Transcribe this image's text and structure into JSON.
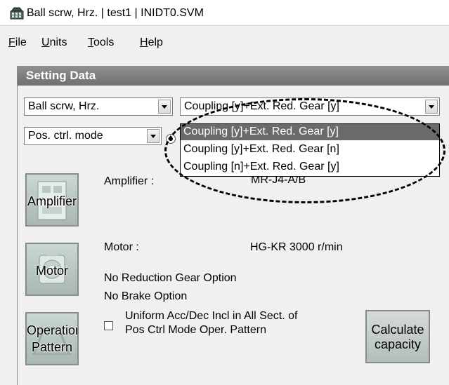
{
  "window": {
    "title": "Ball scrw, Hrz.  | test1 | INIDT0.SVM",
    "icon": "app-grid-icon"
  },
  "menu": {
    "items": [
      {
        "label": "File",
        "accel": "F",
        "rest": "ile"
      },
      {
        "label": "Units",
        "accel": "U",
        "rest": "nits"
      },
      {
        "label": "Tools",
        "accel": "T",
        "rest": "ools"
      },
      {
        "label": "Help",
        "accel": "H",
        "rest": "elp"
      }
    ]
  },
  "panel": {
    "title": "Setting Data",
    "mechanism_select": "Ball scrw, Hrz.",
    "gear_select": "Coupling [y]+Ext. Red. Gear [y]",
    "mode_select": "Pos. ctrl. mode",
    "gear_options": [
      "Coupling [y]+Ext. Red. Gear [y]",
      "Coupling [y]+Ext. Red. Gear [n]",
      "Coupling [n]+Ext. Red. Gear [y]"
    ],
    "gear_selected_index": 0,
    "amplifier": {
      "button_label": "Amplifier",
      "label": "Amplifier :",
      "value": "MR-J4-A/B"
    },
    "motor": {
      "button_label": "Motor",
      "label": "Motor :",
      "value": "HG-KR  3000 r/min",
      "reduction_gear": "No Reduction Gear Option",
      "brake": "No Brake Option"
    },
    "operation": {
      "button_label_1": "Operation",
      "button_label_2": "Pattern",
      "checkbox_line_1": "Uniform Acc/Dec Incl in All Sect. of",
      "checkbox_line_2": "Pos Ctrl Mode Oper. Pattern",
      "checked": false
    },
    "calculate": {
      "label_1": "Calculate",
      "label_2": "capacity"
    }
  },
  "colors": {
    "panel_header": "#7f7f7f",
    "selected_option": "#6a6a6a",
    "window_bg": "#f0f0f0"
  }
}
